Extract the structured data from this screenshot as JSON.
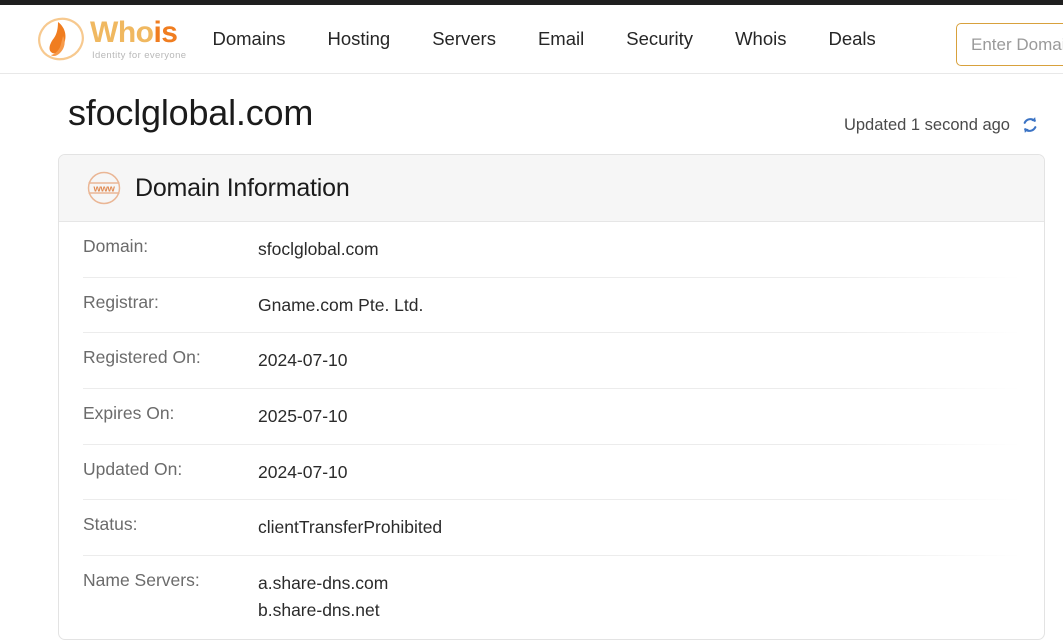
{
  "header": {
    "logo": {
      "word_part_1": "Who",
      "word_part_2": "is",
      "tagline": "Identity for everyone",
      "mark_icon": "whois-flame-mark-icon",
      "colors": {
        "light": "#f0b860",
        "strong": "#f07d20"
      }
    },
    "nav": [
      {
        "label": "Domains",
        "name": "nav-domains"
      },
      {
        "label": "Hosting",
        "name": "nav-hosting"
      },
      {
        "label": "Servers",
        "name": "nav-servers"
      },
      {
        "label": "Email",
        "name": "nav-email"
      },
      {
        "label": "Security",
        "name": "nav-security"
      },
      {
        "label": "Whois",
        "name": "nav-whois"
      },
      {
        "label": "Deals",
        "name": "nav-deals"
      }
    ],
    "search": {
      "placeholder": "Enter Domain Name",
      "value": "",
      "border_color": "#d8a13c"
    }
  },
  "page": {
    "title": "sfoclglobal.com",
    "updated_text": "Updated 1 second ago",
    "refresh_icon": "refresh-icon",
    "refresh_icon_color": "#3b73c4"
  },
  "card": {
    "icon": "www-globe-icon",
    "icon_text": "www",
    "icon_color": "#e09a6d",
    "title": "Domain Information",
    "rows": [
      {
        "label": "Domain:",
        "value": "sfoclglobal.com",
        "name": "row-domain"
      },
      {
        "label": "Registrar:",
        "value": "Gname.com Pte. Ltd.",
        "name": "row-registrar"
      },
      {
        "label": "Registered On:",
        "value": "2024-07-10",
        "name": "row-registered-on"
      },
      {
        "label": "Expires On:",
        "value": "2025-07-10",
        "name": "row-expires-on"
      },
      {
        "label": "Updated On:",
        "value": "2024-07-10",
        "name": "row-updated-on"
      },
      {
        "label": "Status:",
        "value": "clientTransferProhibited",
        "name": "row-status"
      }
    ],
    "name_servers_row": {
      "label": "Name Servers:",
      "values": [
        "a.share-dns.com",
        "b.share-dns.net"
      ],
      "name": "row-name-servers"
    }
  }
}
